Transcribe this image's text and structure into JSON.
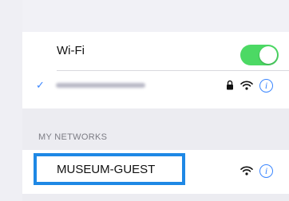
{
  "wifi": {
    "label": "Wi-Fi",
    "enabled": true,
    "accent": "#4cd964"
  },
  "connected_network": {
    "name_obscured": true,
    "check_icon": "checkmark-icon",
    "icons": [
      "lock-icon",
      "wifi-signal-icon",
      "info-icon"
    ]
  },
  "my_networks": {
    "header": "MY NETWORKS",
    "items": [
      {
        "label": "MUSEUM-GUEST",
        "highlight_color": "#1e88e5",
        "icons": [
          "wifi-signal-icon",
          "info-icon"
        ]
      }
    ]
  },
  "colors": {
    "info_blue": "#3a86ff",
    "background": "#efeff4"
  }
}
